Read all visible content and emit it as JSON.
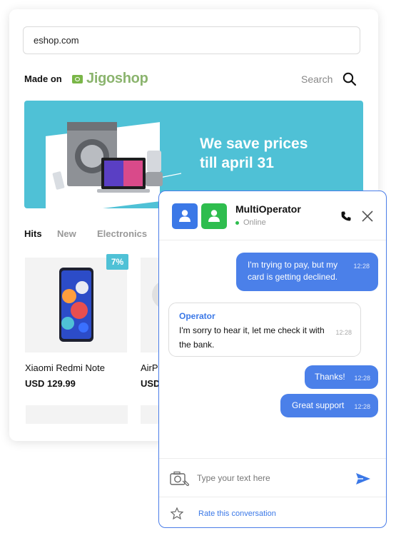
{
  "shop": {
    "url": "eshop.com",
    "made_on": "Made on",
    "brand": "Jigoshop",
    "search_label": "Search",
    "banner_text_line1": "We save prices",
    "banner_text_line2": "till april 31",
    "tabs": [
      "Hits",
      "New",
      "Electronics"
    ],
    "products": [
      {
        "name": "Xiaomi Redmi Note",
        "price": "USD 129.99",
        "badge": "7%"
      },
      {
        "name": "AirP",
        "price": "USD"
      }
    ]
  },
  "chat": {
    "operator_name": "MultiOperator",
    "status": "Online",
    "messages": [
      {
        "from": "user",
        "text": "I'm trying to pay, but my card is getting declined.",
        "time": "12:28"
      },
      {
        "from": "operator",
        "sender": "Operator",
        "text": "I'm sorry to hear it, let me check it with the bank.",
        "time": "12:28"
      },
      {
        "from": "user",
        "text": "Thanks!",
        "time": "12:28"
      },
      {
        "from": "user",
        "text": "Great support",
        "time": "12:28"
      }
    ],
    "input_placeholder": "Type your text here",
    "rate_label": "Rate this conversation"
  },
  "colors": {
    "accent": "#4b80e9",
    "banner": "#4fc1d6",
    "online": "#2ebd4e",
    "brand_green": "#8bb46e"
  },
  "icons": [
    "search-icon",
    "phone-icon",
    "close-icon",
    "camera-attach-icon",
    "send-icon",
    "star-icon",
    "user-avatar-icon"
  ]
}
